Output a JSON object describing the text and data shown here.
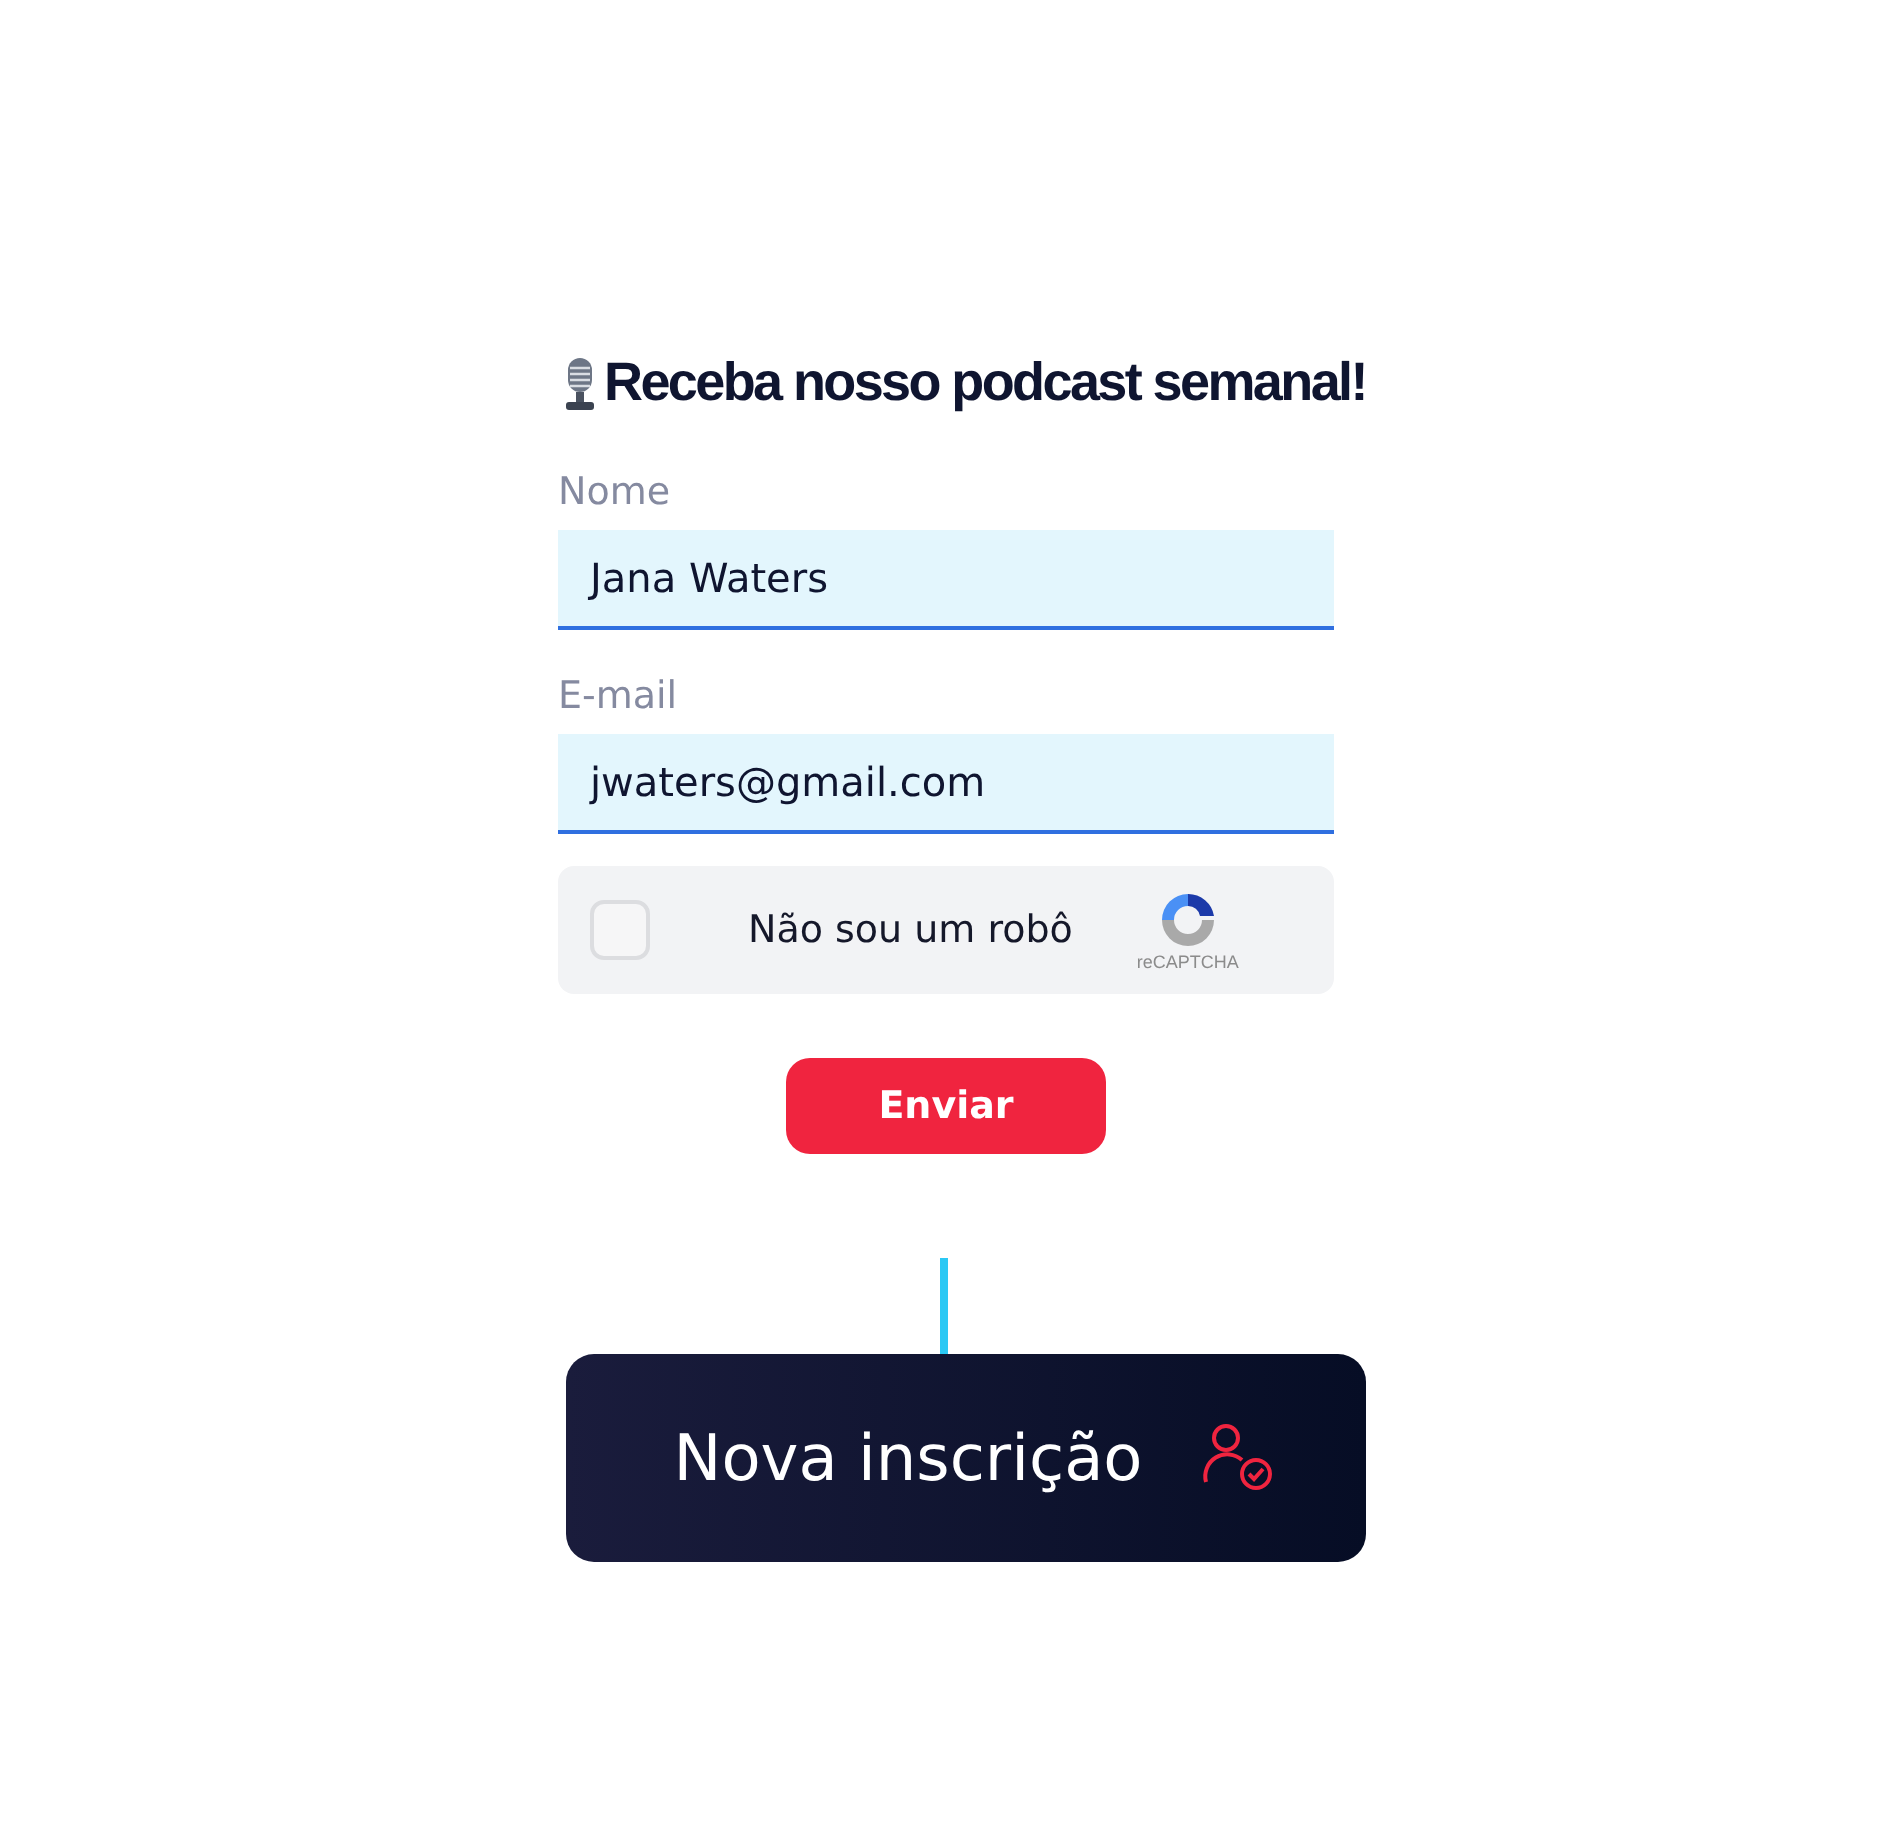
{
  "title": "Receba nosso podcast semanal!",
  "fields": [
    {
      "label": "Nome",
      "value": "Jana Waters"
    },
    {
      "label": "E-mail",
      "value": "jwaters@gmail.com"
    }
  ],
  "captcha": {
    "label": "Não sou um robô",
    "checked": false,
    "brand": "reCAPTCHA"
  },
  "submit_button": "Enviar",
  "event_card": {
    "label": "Nova inscrição"
  }
}
